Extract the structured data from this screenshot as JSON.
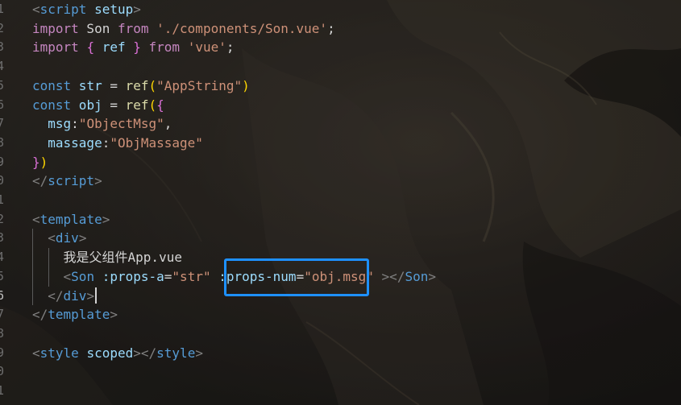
{
  "colors": {
    "highlight": "#1e90ff",
    "keyword": "#c586c0",
    "variable": "#9cdcfe",
    "string": "#ce9178",
    "tag": "#569cd6",
    "function": "#dcdcaa"
  },
  "lines": [
    {
      "n": "1",
      "tokens": [
        [
          "tag",
          "<"
        ],
        [
          "tagname",
          "script"
        ],
        [
          "tok-text",
          " "
        ],
        [
          "attr",
          "setup"
        ],
        [
          "tag",
          ">"
        ]
      ]
    },
    {
      "n": "2",
      "tokens": [
        [
          "kw",
          "import"
        ],
        [
          "text",
          " Son "
        ],
        [
          "kw",
          "from"
        ],
        [
          "text",
          " "
        ],
        [
          "str",
          "'./components/Son.vue'"
        ],
        [
          "punc",
          ";"
        ]
      ]
    },
    {
      "n": "3",
      "tokens": [
        [
          "kw",
          "import"
        ],
        [
          "text",
          " "
        ],
        [
          "brace",
          "{"
        ],
        [
          "var",
          " ref "
        ],
        [
          "brace",
          "}"
        ],
        [
          "text",
          " "
        ],
        [
          "kw",
          "from"
        ],
        [
          "text",
          " "
        ],
        [
          "str",
          "'vue'"
        ],
        [
          "punc",
          ";"
        ]
      ]
    },
    {
      "n": "4",
      "tokens": []
    },
    {
      "n": "5",
      "tokens": [
        [
          "const",
          "const"
        ],
        [
          "var",
          " str"
        ],
        [
          "text",
          " = "
        ],
        [
          "fn",
          "ref"
        ],
        [
          "paren",
          "("
        ],
        [
          "str",
          "\"AppString\""
        ],
        [
          "paren",
          ")"
        ]
      ]
    },
    {
      "n": "6",
      "tokens": [
        [
          "const",
          "const"
        ],
        [
          "var",
          " obj"
        ],
        [
          "text",
          " = "
        ],
        [
          "fn",
          "ref"
        ],
        [
          "paren",
          "("
        ],
        [
          "brace",
          "{"
        ]
      ]
    },
    {
      "n": "7",
      "tokens": [
        [
          "text",
          "  "
        ],
        [
          "prop",
          "msg"
        ],
        [
          "punc",
          ":"
        ],
        [
          "str",
          "\"ObjectMsg\""
        ],
        [
          "punc",
          ","
        ]
      ]
    },
    {
      "n": "8",
      "tokens": [
        [
          "text",
          "  "
        ],
        [
          "prop",
          "massage"
        ],
        [
          "punc",
          ":"
        ],
        [
          "str",
          "\"ObjMassage\""
        ]
      ]
    },
    {
      "n": "9",
      "tokens": [
        [
          "brace",
          "}"
        ],
        [
          "paren",
          ")"
        ]
      ]
    },
    {
      "n": "0",
      "tokens": [
        [
          "tag",
          "</"
        ],
        [
          "tagname",
          "script"
        ],
        [
          "tag",
          ">"
        ]
      ]
    },
    {
      "n": "1",
      "tokens": []
    },
    {
      "n": "2",
      "tokens": [
        [
          "tag",
          "<"
        ],
        [
          "tagname",
          "template"
        ],
        [
          "tag",
          ">"
        ]
      ]
    },
    {
      "n": "3",
      "tokens": [
        [
          "text",
          "  "
        ],
        [
          "tag",
          "<"
        ],
        [
          "tagname",
          "div"
        ],
        [
          "tag",
          ">"
        ]
      ]
    },
    {
      "n": "4",
      "tokens": [
        [
          "text",
          "    我是父组件App.vue"
        ]
      ]
    },
    {
      "n": "5",
      "tokens": [
        [
          "text",
          "    "
        ],
        [
          "tag",
          "<"
        ],
        [
          "tagname",
          "Son"
        ],
        [
          "text",
          " "
        ],
        [
          "attr",
          ":props-a"
        ],
        [
          "text",
          "="
        ],
        [
          "str",
          "\"str\""
        ],
        [
          "text",
          " "
        ],
        [
          "attr",
          ":props-num"
        ],
        [
          "text",
          "="
        ],
        [
          "str",
          "\"obj.msg\""
        ],
        [
          "text",
          " "
        ],
        [
          "tag",
          "></"
        ],
        [
          "tagname",
          "Son"
        ],
        [
          "tag",
          ">"
        ]
      ]
    },
    {
      "n": "6",
      "tokens": [
        [
          "text",
          "  "
        ],
        [
          "tag",
          "</"
        ],
        [
          "tagname",
          "div"
        ],
        [
          "tag",
          ">"
        ]
      ],
      "active": true
    },
    {
      "n": "7",
      "tokens": [
        [
          "tag",
          "</"
        ],
        [
          "tagname",
          "template"
        ],
        [
          "tag",
          ">"
        ]
      ]
    },
    {
      "n": "8",
      "tokens": []
    },
    {
      "n": "9",
      "tokens": [
        [
          "tag",
          "<"
        ],
        [
          "tagname",
          "style"
        ],
        [
          "text",
          " "
        ],
        [
          "attr",
          "scoped"
        ],
        [
          "tag",
          "></"
        ],
        [
          "tagname",
          "style"
        ],
        [
          "tag",
          ">"
        ]
      ]
    },
    {
      "n": "0",
      "tokens": []
    },
    {
      "n": "1",
      "tokens": []
    }
  ]
}
